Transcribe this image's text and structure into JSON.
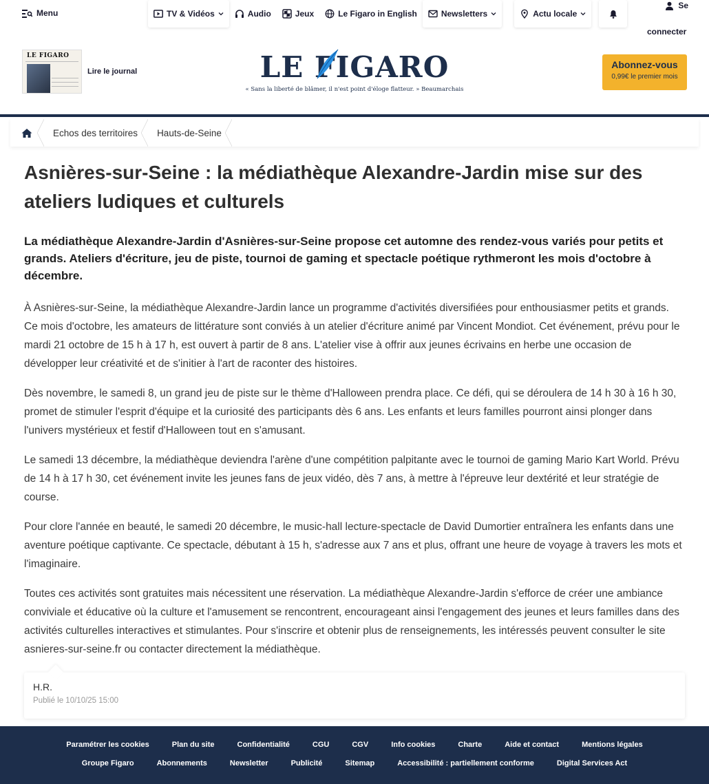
{
  "topnav": {
    "menu_label": "Menu",
    "items": [
      {
        "label": "TV & Vidéos",
        "icon": "play-icon",
        "dropdown": true
      },
      {
        "label": "Audio",
        "icon": "headphones-icon",
        "dropdown": false
      },
      {
        "label": "Jeux",
        "icon": "grid-icon",
        "dropdown": false
      },
      {
        "label": "Le Figaro in English",
        "icon": "globe-icon",
        "dropdown": false
      },
      {
        "label": "Newsletters",
        "icon": "mail-icon",
        "dropdown": true
      },
      {
        "label": "Actu locale",
        "icon": "location-pin-icon",
        "dropdown": true
      }
    ],
    "login_line1": "Se",
    "login_line2": "connecter"
  },
  "masthead": {
    "journal_label": "Lire le journal",
    "journal_thumb_title": "LE FIGARO",
    "logo_text": "LE FIGARO",
    "tagline": "« Sans la liberté de blâmer, il n'est point d'éloge flatteur. » Beaumarchais",
    "subscribe_title": "Abonnez-vous",
    "subscribe_sub": "0,99€ le premier mois",
    "brand_color": "#1d2e4b",
    "accent_color": "#f3b22c"
  },
  "breadcrumb": {
    "items": [
      "Echos des territoires",
      "Hauts-de-Seine"
    ]
  },
  "article": {
    "title": "Asnières-sur-Seine : la médiathèque Alexandre-Jardin mise sur des ateliers ludiques et culturels",
    "lead": "La médiathèque Alexandre-Jardin d'Asnières-sur-Seine propose cet automne des rendez-vous variés pour petits et grands. Ateliers d'écriture, jeu de piste, tournoi de gaming et spectacle poétique rythmeront les mois d'octobre à décembre.",
    "paragraphs": [
      "À Asnières-sur-Seine, la médiathèque Alexandre-Jardin lance un programme d'activités diversifiées pour enthousiasmer petits et grands. Ce mois d'octobre, les amateurs de littérature sont conviés à un atelier d'écriture animé par Vincent Mondiot. Cet événement, prévu pour le mardi 21 octobre de 15 h à 17 h, est ouvert à partir de 8 ans. L'atelier vise à offrir aux jeunes écrivains en herbe une occasion de développer leur créativité et de s'initier à l'art de raconter des histoires.",
      "Dès novembre, le samedi 8, un grand jeu de piste sur le thème d'Halloween prendra place. Ce défi, qui se déroulera de 14 h 30 à 16 h 30, promet de stimuler l'esprit d'équipe et la curiosité des participants dès 6 ans. Les enfants et leurs familles pourront ainsi plonger dans l'univers mystérieux et festif d'Halloween tout en s'amusant.",
      "Le samedi 13 décembre, la médiathèque deviendra l'arène d'une compétition palpitante avec le tournoi de gaming Mario Kart World. Prévu de 14 h à 17 h 30, cet événement invite les jeunes fans de jeux vidéo, dès 7 ans, à mettre à l'épreuve leur dextérité et leur stratégie de course.",
      "Pour clore l'année en beauté, le samedi 20 décembre, le music-hall lecture-spectacle de David Dumortier entraînera les enfants dans une aventure poétique captivante. Ce spectacle, débutant à 15 h, s'adresse aux 7 ans et plus, offrant une heure de voyage à travers les mots et l'imaginaire.",
      "Toutes ces activités sont gratuites mais nécessitent une réservation. La médiathèque Alexandre-Jardin s'efforce de créer une ambiance conviviale et éducative où la culture et l'amusement se rencontrent, encourageant ainsi l'engagement des jeunes et leurs familles dans des activités culturelles interactives et stimulantes. Pour s'inscrire et obtenir plus de renseignements, les intéressés peuvent consulter le site asnieres-sur-seine.fr ou contacter directement la médiathèque."
    ],
    "author": "H.R.",
    "published": "Publié le 10/10/25 15:00"
  },
  "footer": {
    "row1": [
      "Paramétrer les cookies",
      "Plan du site",
      "Confidentialité",
      "CGU",
      "CGV",
      "Info cookies",
      "Charte",
      "Aide et contact",
      "Mentions légales"
    ],
    "row2": [
      "Groupe Figaro",
      "Abonnements",
      "Newsletter",
      "Publicité",
      "Sitemap",
      "Accessibilité : partiellement conforme",
      "Digital Services Act"
    ]
  }
}
